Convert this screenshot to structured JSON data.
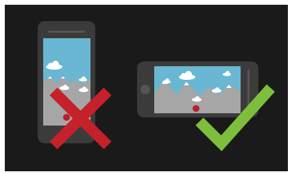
{
  "illustration": {
    "wrong_icon": "cross-mark-icon",
    "right_icon": "check-mark-icon",
    "portrait_phone_icon": "phone-portrait-icon",
    "landscape_phone_icon": "phone-landscape-icon",
    "record_button_icon": "record-button-icon"
  },
  "colors": {
    "background": "#1a1a1a",
    "phone_body": "#3b3b3b",
    "phone_detail": "#555555",
    "sky": "#69b7d2",
    "mountain": "#a6a6a6",
    "cloud": "#ffffff",
    "record_button": "#b7202a",
    "wrong_mark": "#c42129",
    "right_mark": "#7dbf3c"
  }
}
